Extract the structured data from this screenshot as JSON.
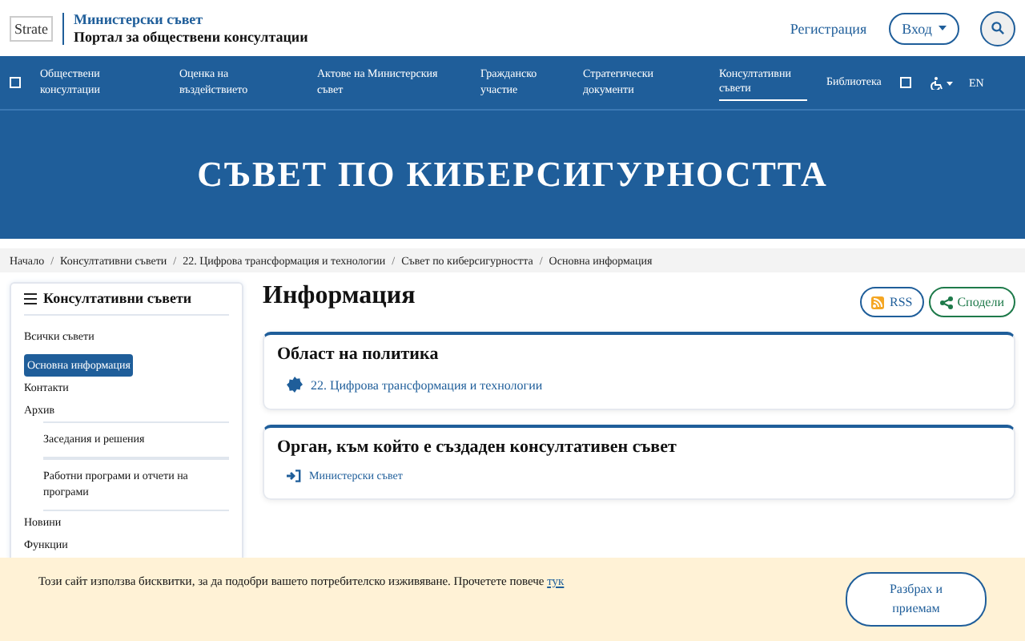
{
  "header": {
    "logo_alt": "Strate",
    "org": "Министерски съвет",
    "portal": "Портал за обществени консултации",
    "register": "Регистрация",
    "login": "Вход"
  },
  "nav": {
    "items": [
      {
        "label": "Обществени консултации",
        "selected": false
      },
      {
        "label": "Оценка на въздействието",
        "selected": false
      },
      {
        "label": "Актове на Министерския съвет",
        "selected": false
      },
      {
        "label": "Гражданско участие",
        "selected": false
      },
      {
        "label": "Стратегически документи",
        "selected": false
      },
      {
        "label": "Консултативни съвети",
        "selected": true
      },
      {
        "label": "Библиотека",
        "selected": false
      }
    ],
    "language": "EN"
  },
  "banner": {
    "title": "СЪВЕТ ПО КИБЕРСИГУРНОСТТА"
  },
  "breadcrumb_separator": "/",
  "breadcrumbs": [
    "Начало",
    "Консултативни съвети",
    "22. Цифрова трансформация и технологии",
    "Съвет по киберсигурността",
    "Основна информация"
  ],
  "sidebar": {
    "title": "Консултативни съвети",
    "items": [
      {
        "label": "Всички съвети",
        "selected": false
      },
      {
        "label": "Основна информация",
        "selected": true
      },
      {
        "label": "Контакти",
        "selected": false
      },
      {
        "label": "Архив",
        "selected": false,
        "children": [
          {
            "label": "Заседания и решения",
            "selected": false
          },
          {
            "label": "Работни програми и отчети на програми",
            "selected": false
          }
        ]
      },
      {
        "label": "Новини",
        "selected": false
      },
      {
        "label": "Функции",
        "selected": false
      }
    ]
  },
  "main": {
    "title": "Информация",
    "actions": [
      {
        "kind": "rss",
        "label": "RSS"
      },
      {
        "kind": "share",
        "label": "Сподели"
      }
    ],
    "cards": [
      {
        "title": "Област на политика",
        "kind": "policy",
        "link": "22. Цифрова трансформация и технологии"
      },
      {
        "title": "Орган, към който е създаден консултативен съвет",
        "kind": "body",
        "link": "Министерски съвет"
      }
    ]
  },
  "cookie": {
    "text": "Този сайт използва бисквитки, за да подобри вашето потребителско изживяване. Прочетете повече",
    "link": "тук",
    "button": "Разбрах и приемам"
  }
}
